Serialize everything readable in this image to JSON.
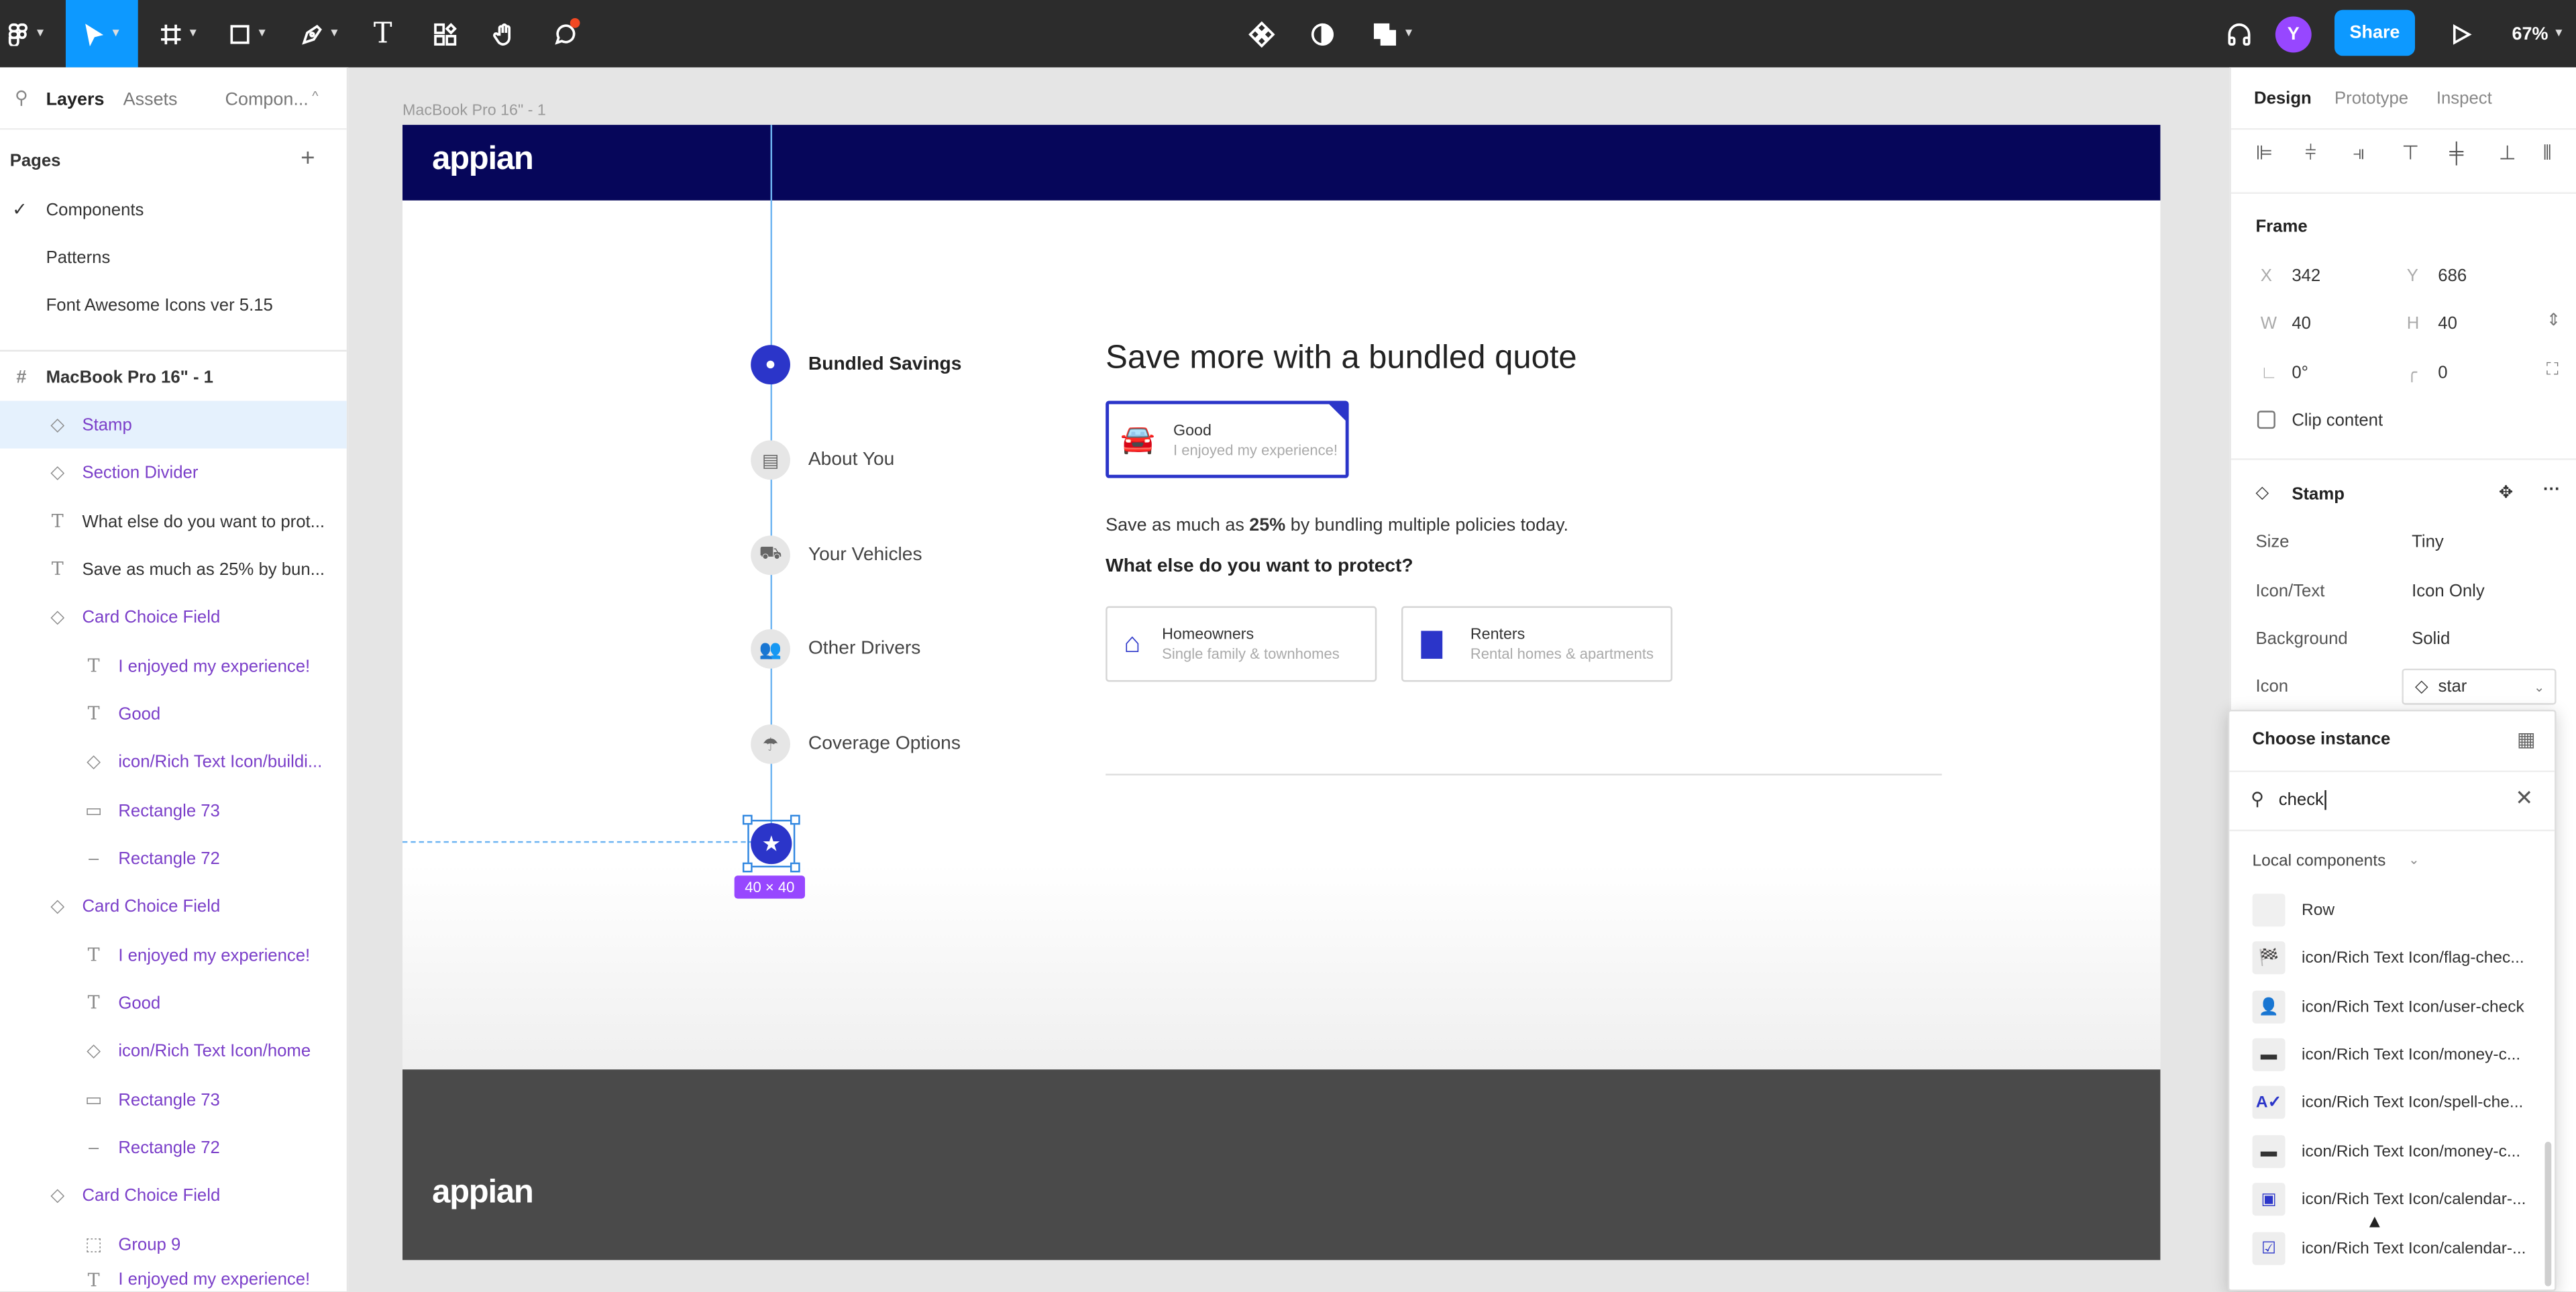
{
  "toolbar": {
    "share": "Share",
    "avatar_initial": "Y",
    "zoom": "67%",
    "icons": [
      "figma-menu-icon",
      "move-tool-icon",
      "frame-tool-icon",
      "shape-tool-icon",
      "pen-tool-icon",
      "text-tool-icon",
      "resources-icon",
      "hand-tool-icon",
      "comment-icon",
      "component-icon",
      "contrast-icon",
      "boolean-icon",
      "headphones-icon",
      "present-icon"
    ]
  },
  "left": {
    "tabs": {
      "layers": "Layers",
      "assets": "Assets",
      "components": "Compon..."
    },
    "pages_title": "Pages",
    "pages": [
      "Components",
      "Patterns",
      "Font Awesome Icons ver 5.15"
    ],
    "frame_name": "MacBook Pro 16\" - 1",
    "layers": [
      "Stamp",
      "Section Divider",
      "What else do you want to prot...",
      "Save as much as 25% by bun...",
      "Card Choice Field",
      "I enjoyed my experience!",
      "Good",
      "icon/Rich Text Icon/buildi...",
      "Rectangle 73",
      "Rectangle 72",
      "Card Choice Field",
      "I enjoyed my experience!",
      "Good",
      "icon/Rich Text Icon/home",
      "Rectangle 73",
      "Rectangle 72",
      "Card Choice Field",
      "Group 9",
      "I enjoyed my experience!"
    ]
  },
  "canvas": {
    "frame_label": "MacBook Pro 16\" - 1",
    "logo": "appian",
    "footer_logo": "appian",
    "size_badge": "40 × 40",
    "steps": [
      "Bundled Savings",
      "About You",
      "Your Vehicles",
      "Other Drivers",
      "Coverage Options"
    ],
    "heading": "Save more with a bundled quote",
    "selected_card": {
      "title": "Good",
      "subtitle": "I enjoyed my experience!"
    },
    "savings_pre": "Save as much as ",
    "savings_bold": "25%",
    "savings_post": " by bundling multiple policies today.",
    "question": "What else do you want to protect?",
    "cards": [
      {
        "title": "Homeowners",
        "subtitle": "Single family & townhomes"
      },
      {
        "title": "Renters",
        "subtitle": "Rental homes & apartments"
      }
    ],
    "accent": "#2b35c9",
    "header_bg": "#06065a"
  },
  "right": {
    "tabs": {
      "design": "Design",
      "prototype": "Prototype",
      "inspect": "Inspect"
    },
    "frame_title": "Frame",
    "x_label": "X",
    "x": "342",
    "y_label": "Y",
    "y": "686",
    "w_label": "W",
    "w": "40",
    "h_label": "H",
    "h": "40",
    "rotation": "0°",
    "radius": "0",
    "clip": "Clip content",
    "component_name": "Stamp",
    "props": [
      {
        "label": "Size",
        "value": "Tiny"
      },
      {
        "label": "Icon/Text",
        "value": "Icon Only"
      },
      {
        "label": "Background",
        "value": "Solid"
      },
      {
        "label": "Icon",
        "value": "star"
      }
    ]
  },
  "popup": {
    "title": "Choose instance",
    "search_value": "check",
    "section": "Local components",
    "items": [
      "Row",
      "icon/Rich Text Icon/flag-chec...",
      "icon/Rich Text Icon/user-check",
      "icon/Rich Text Icon/money-c...",
      "icon/Rich Text Icon/spell-che...",
      "icon/Rich Text Icon/money-c...",
      "icon/Rich Text Icon/calendar-...",
      "icon/Rich Text Icon/calendar-..."
    ]
  }
}
